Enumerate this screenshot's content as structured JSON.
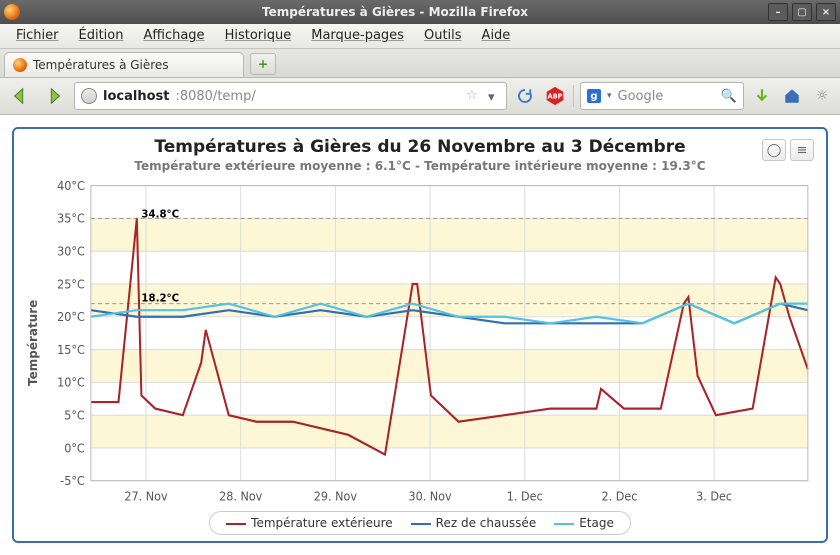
{
  "window": {
    "title": "Températures à Gières - Mozilla Firefox"
  },
  "menubar": {
    "items": [
      "Fichier",
      "Édition",
      "Affichage",
      "Historique",
      "Marque-pages",
      "Outils",
      "Aide"
    ]
  },
  "tab": {
    "label": "Températures à Gières"
  },
  "url": {
    "host": "localhost",
    "port_path": ":8080/temp/"
  },
  "search": {
    "placeholder": "Google"
  },
  "chart": {
    "title": "Températures à Gières du 26 Novembre au 3 Décembre",
    "subtitle": "Température extérieure moyenne : 6.1°C - Température intérieure moyenne : 19.3°C",
    "ylabel": "Température",
    "legend": [
      "Température extérieure",
      "Rez de chaussée",
      "Etage"
    ],
    "peak_label_ext": "34.8°C",
    "peak_label_int": "18.2°C"
  },
  "chart_data": {
    "type": "line",
    "ylabel": "Température",
    "ylim": [
      -5,
      40
    ],
    "yticks": [
      "-5°C",
      "0°C",
      "5°C",
      "10°C",
      "15°C",
      "20°C",
      "25°C",
      "30°C",
      "35°C",
      "40°C"
    ],
    "xticks": [
      "27. Nov",
      "28. Nov",
      "29. Nov",
      "30. Nov",
      "1. Dec",
      "2. Dec",
      "3. Dec"
    ],
    "point_labels": [
      {
        "series": "ext",
        "x": 0.5,
        "y": 34.8,
        "label": "34.8°C"
      },
      {
        "series": "rdc",
        "x": 0.5,
        "y": 18.2,
        "label": "18.2°C"
      }
    ],
    "series": [
      {
        "name": "Température extérieure",
        "color": "#a8242a",
        "x": [
          0,
          0.3,
          0.5,
          0.55,
          0.7,
          1.0,
          1.2,
          1.25,
          1.5,
          1.8,
          2.2,
          2.8,
          3.2,
          3.5,
          3.55,
          3.7,
          4.0,
          4.5,
          5.0,
          5.3,
          5.5,
          5.55,
          5.8,
          6.2,
          6.45,
          6.5,
          6.6,
          6.8,
          7.2,
          7.45,
          7.5,
          7.6,
          7.8
        ],
        "values": [
          7,
          7,
          35,
          8,
          6,
          5,
          13,
          18,
          5,
          4,
          4,
          2,
          -1,
          25,
          25,
          8,
          4,
          5,
          6,
          6,
          6,
          9,
          6,
          6,
          22,
          23,
          11,
          5,
          6,
          26,
          25,
          20,
          12
        ]
      },
      {
        "name": "Rez de chaussée",
        "color": "#2f6fb8",
        "x": [
          0,
          0.5,
          1.0,
          1.5,
          2.0,
          2.5,
          3.0,
          3.5,
          4.0,
          4.5,
          5.0,
          5.5,
          6.0,
          6.5,
          7.0,
          7.5,
          7.8
        ],
        "values": [
          21,
          20,
          20,
          21,
          20,
          21,
          20,
          21,
          20,
          19,
          19,
          19,
          19,
          22,
          19,
          22,
          21
        ]
      },
      {
        "name": "Etage",
        "color": "#55c3e0",
        "x": [
          0,
          0.5,
          1.0,
          1.5,
          2.0,
          2.5,
          3.0,
          3.5,
          4.0,
          4.5,
          5.0,
          5.5,
          6.0,
          6.5,
          7.0,
          7.5,
          7.8
        ],
        "values": [
          20,
          21,
          21,
          22,
          20,
          22,
          20,
          22,
          20,
          20,
          19,
          20,
          19,
          22,
          19,
          22,
          22
        ]
      }
    ]
  }
}
